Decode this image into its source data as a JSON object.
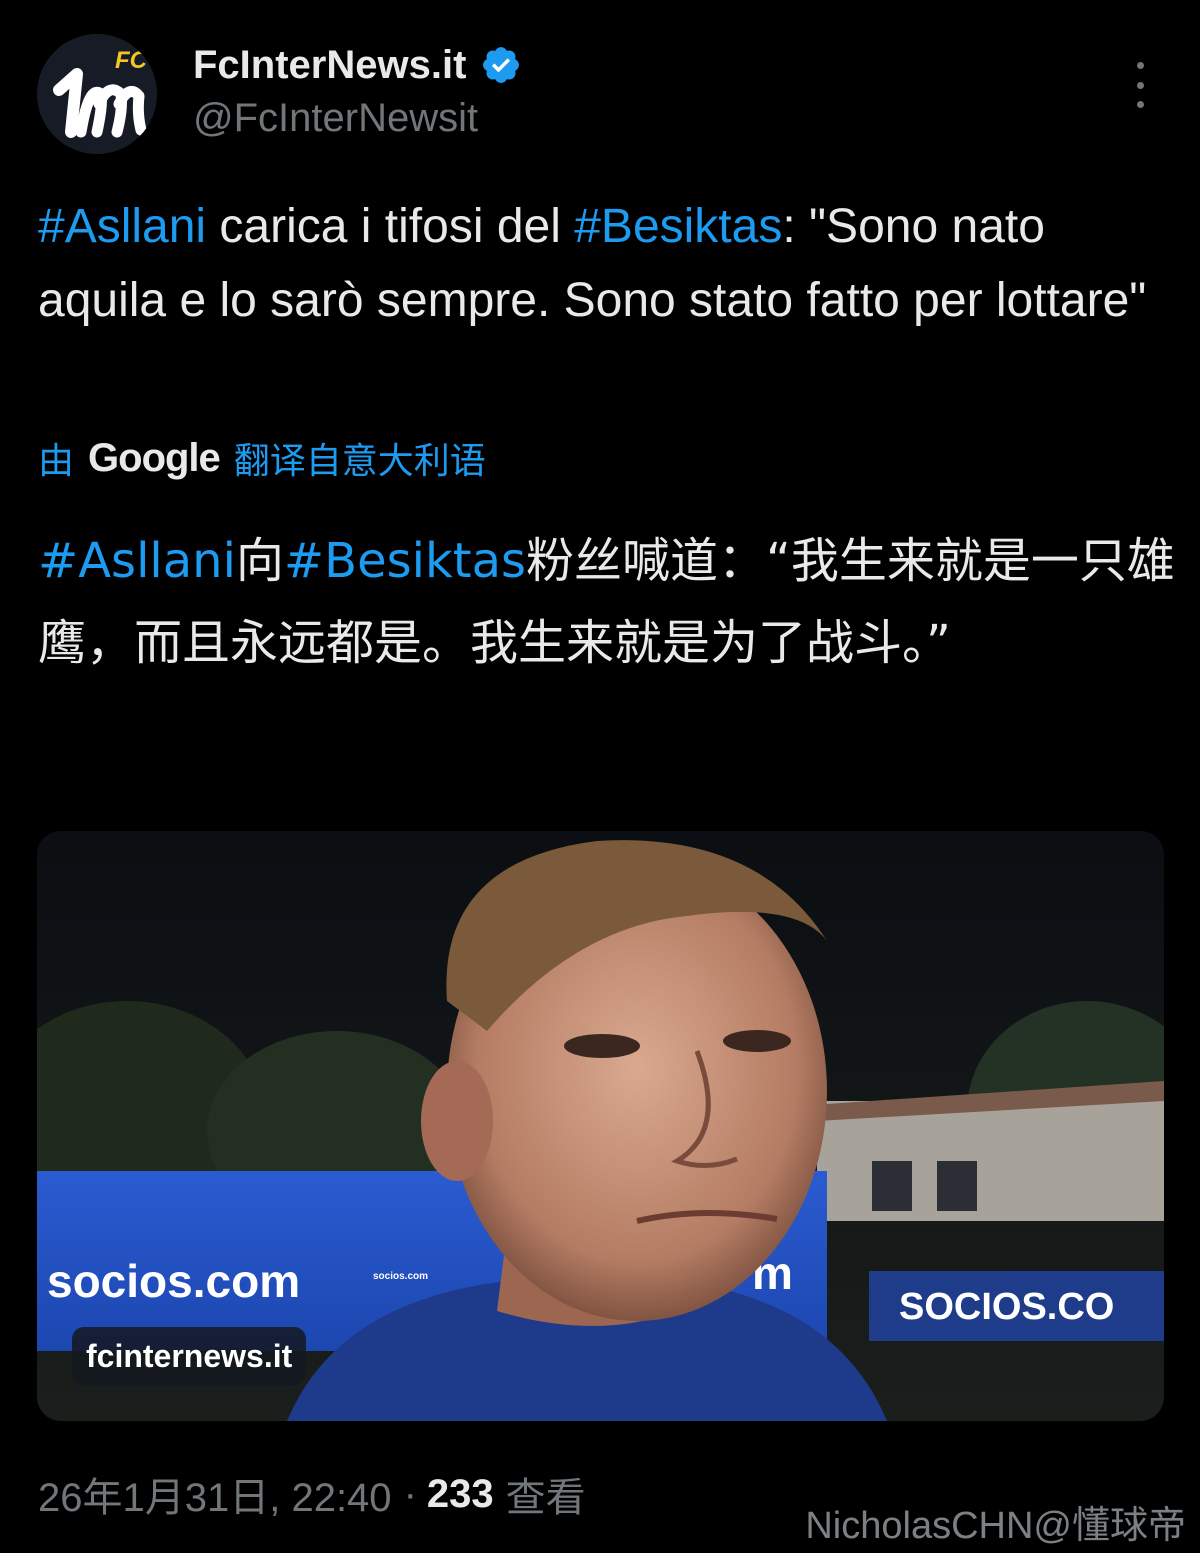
{
  "header": {
    "avatar_badge": "FC",
    "display_name": "FcInterNews.it",
    "handle": "@FcInterNewsit"
  },
  "tweet": {
    "segments": [
      {
        "text": "#Asllani",
        "hashtag": true
      },
      {
        "text": " carica i tifosi del ",
        "hashtag": false
      },
      {
        "text": "#Besiktas",
        "hashtag": true
      },
      {
        "text": ": \"Sono nato aquila e lo sarò sempre. Sono stato fatto per lottare\"",
        "hashtag": false
      }
    ]
  },
  "translation": {
    "prefix": "由",
    "provider": "Google",
    "suffix": "翻译自意大利语",
    "segments": [
      {
        "text": "#Asllani",
        "hashtag": true
      },
      {
        "text": "向",
        "hashtag": false
      },
      {
        "text": "#Besiktas",
        "hashtag": true
      },
      {
        "text": "粉丝喊道：“我生来就是一只雄鹰，而且永远都是。我生来就是为了战斗。”",
        "hashtag": false
      }
    ]
  },
  "media": {
    "caption": "fcinternews.it",
    "board_left": "socios.com",
    "board_left_small": "socios.com",
    "board_mid": "m",
    "board_right": "SOCIOS.CO"
  },
  "meta": {
    "timestamp": "26年1月31日, 22:40",
    "separator": "·",
    "views": "233",
    "views_label": "查看"
  },
  "watermark": "NicholasCHN@懂球帝",
  "colors": {
    "link": "#1d9bf0",
    "verified": "#1d9bf0",
    "muted": "#71767b",
    "text": "#e7e9ea"
  }
}
